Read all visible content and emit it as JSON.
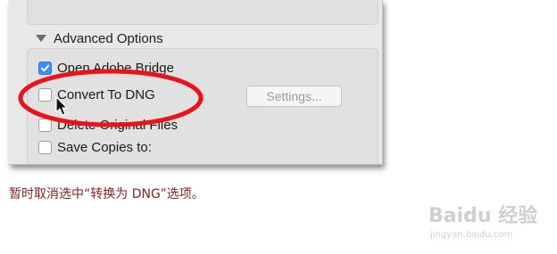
{
  "dialog": {
    "section_title": "Advanced Options",
    "options": [
      {
        "label": "Open Adobe Bridge",
        "checked": true
      },
      {
        "label": "Convert To DNG",
        "checked": false
      },
      {
        "label": "Delete Original Files",
        "checked": false
      },
      {
        "label": "Save Copies to:",
        "checked": false
      }
    ],
    "settings_button": "Settings..."
  },
  "caption": "暂时取消选中“转换为 DNG”选项。",
  "watermark": {
    "brand": "Baidu 经验",
    "url": "jingyan.baidu.com"
  },
  "colors": {
    "highlight": "#e8141a",
    "checkbox_checked": "#3a8ff5",
    "caption_text": "#8b1f1f"
  }
}
